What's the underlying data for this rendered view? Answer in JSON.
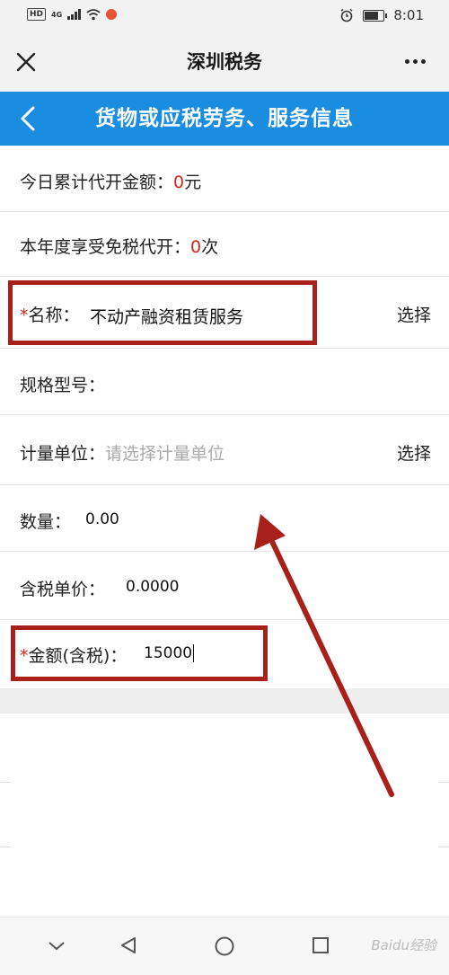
{
  "status_bar": {
    "badges": [
      "HD",
      "4G"
    ],
    "time": "8:01"
  },
  "title_bar": {
    "title": "深圳税务"
  },
  "header": {
    "title": "货物或应税劳务、服务信息"
  },
  "fields": {
    "daily_total": {
      "label": "今日累计代开金额：",
      "value": "0",
      "unit": "元"
    },
    "annual_exempt": {
      "label": "本年度享受免税代开：",
      "value": "0",
      "unit": "次"
    },
    "name": {
      "required_mark": "*",
      "label": "名称：",
      "value": "不动产融资租赁服务",
      "action": "选择"
    },
    "spec": {
      "label": "规格型号："
    },
    "unit": {
      "label": "计量单位：",
      "placeholder": "请选择计量单位",
      "action": "选择"
    },
    "quantity": {
      "label": "数量：",
      "value": "0.00"
    },
    "unit_price": {
      "label": "含税单价：",
      "value": "0.0000"
    },
    "amount": {
      "required_mark": "*",
      "label": "金额(含税)：",
      "value": "15000"
    }
  },
  "watermark": "Baidu经验",
  "colors": {
    "header_blue": "#1b8de0",
    "required_red": "#d0291c",
    "annotation_red": "#a8201a"
  }
}
